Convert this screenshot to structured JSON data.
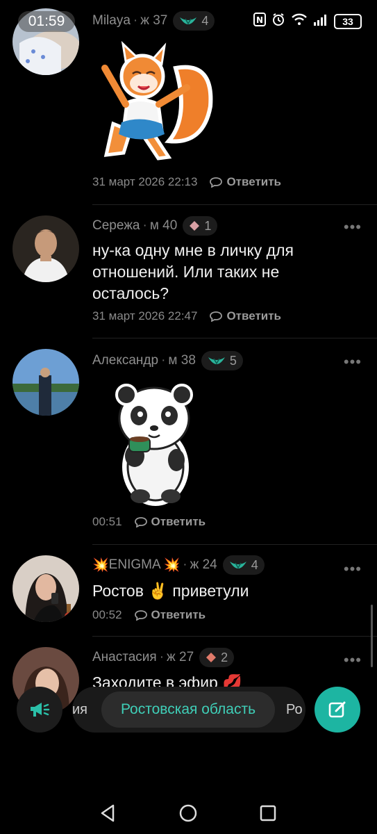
{
  "status_bar": {
    "time": "01:59",
    "battery": "33"
  },
  "posts": [
    {
      "name": "Milaya",
      "gender_age": "ж 37",
      "badge_count": "4",
      "badge_type": "wings-badge-icon",
      "sticker": "fox-girl-sticker",
      "date": "31 март 2026 22:13",
      "reply_label": "Ответить"
    },
    {
      "name": "Сережа",
      "gender_age": "м 40",
      "badge_count": "1",
      "badge_type": "diamond-badge-icon",
      "text": "ну-ка одну мне в личку для отношений. Или таких не осталось?",
      "date": "31 март 2026 22:47",
      "reply_label": "Ответить"
    },
    {
      "name": "Александр",
      "gender_age": "м 38",
      "badge_count": "5",
      "badge_type": "wings-badge-icon",
      "sticker": "panda-tea-sticker",
      "date": "00:51",
      "reply_label": "Ответить"
    },
    {
      "name_prefix": "💥",
      "name": "ENIGMA",
      "name_suffix": "💥",
      "gender_age": "ж 24",
      "badge_count": "4",
      "badge_type": "wings-badge-icon",
      "text": "Ростов ✌️ приветули",
      "date": "00:52",
      "reply_label": "Ответить"
    },
    {
      "name": "Анастасия",
      "gender_age": "ж 27",
      "badge_count": "2",
      "badge_type": "diamond-badge-icon",
      "text": "Заходите в эфир 💋"
    }
  ],
  "more_glyph": "•••",
  "dot_sep": "·",
  "region_selector": {
    "left": "ия",
    "active": "Ростовская область",
    "right": "Ро"
  },
  "colors": {
    "accent": "#1db5a2",
    "accent_text": "#3fcfb8",
    "background": "#000000",
    "badge_wings": "#2ab39a",
    "badge_diamond": "#e07a6a"
  }
}
